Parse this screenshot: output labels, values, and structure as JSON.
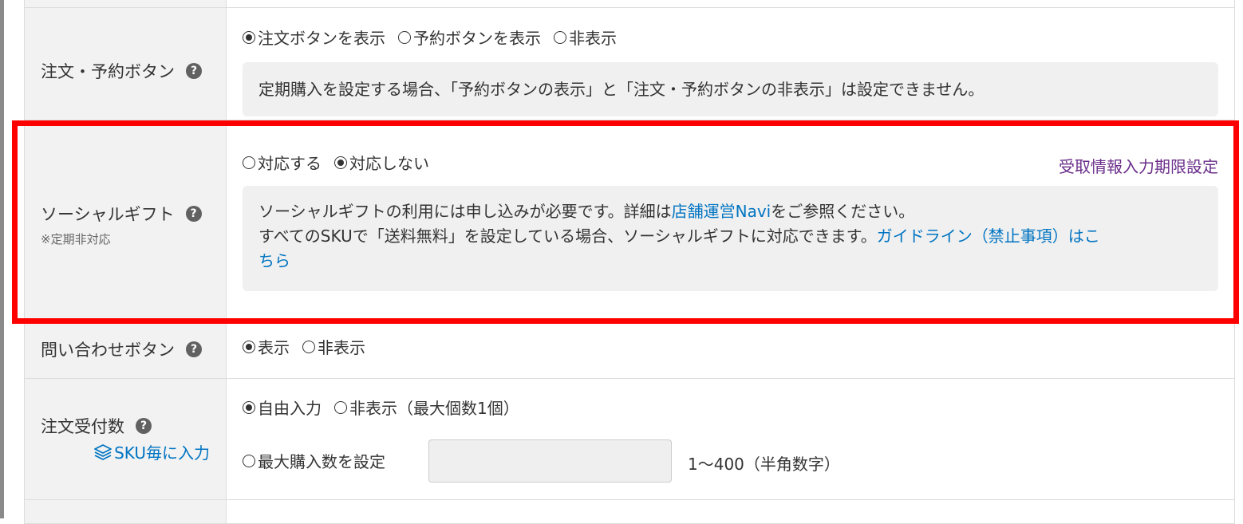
{
  "order_button": {
    "label": "注文・予約ボタン",
    "options": [
      "注文ボタンを表示",
      "予約ボタンを表示",
      "非表示"
    ],
    "selected": 0,
    "note": "定期購入を設定する場合、「予約ボタンの表示」と「注文・予約ボタンの非表示」は設定できません。"
  },
  "social_gift": {
    "label": "ソーシャルギフト",
    "sub_label": "※定期非対応",
    "options": [
      "対応する",
      "対応しない"
    ],
    "selected": 1,
    "deadline_link": "受取情報入力期限設定",
    "note_line1_prefix": "ソーシャルギフトの利用には申し込みが必要です。詳細は",
    "note_navi_link": "店舗運営Navi",
    "note_line1_suffix": "をご参照ください。",
    "note_line2": "すべてのSKUで「送料無料」を設定している場合、ソーシャルギフトに対応できます。",
    "note_guideline_link_a": "ガイドライン（禁止事項）はこ",
    "note_guideline_link_b": "ちら"
  },
  "inquiry_button": {
    "label": "問い合わせボタン",
    "options": [
      "表示",
      "非表示"
    ],
    "selected": 0
  },
  "order_quantity": {
    "label": "注文受付数",
    "sku_link": "SKU毎に入力",
    "options": [
      "自由入力",
      "非表示（最大個数1個）"
    ],
    "selected": 0,
    "max_option": "最大購入数を設定",
    "max_value": "",
    "hint": "1〜400（半角数字）"
  },
  "help_icon_text": "?",
  "highlight_color": "#ff0000",
  "link_color": "#0074c2",
  "visited_link_color": "#6a2e8a"
}
